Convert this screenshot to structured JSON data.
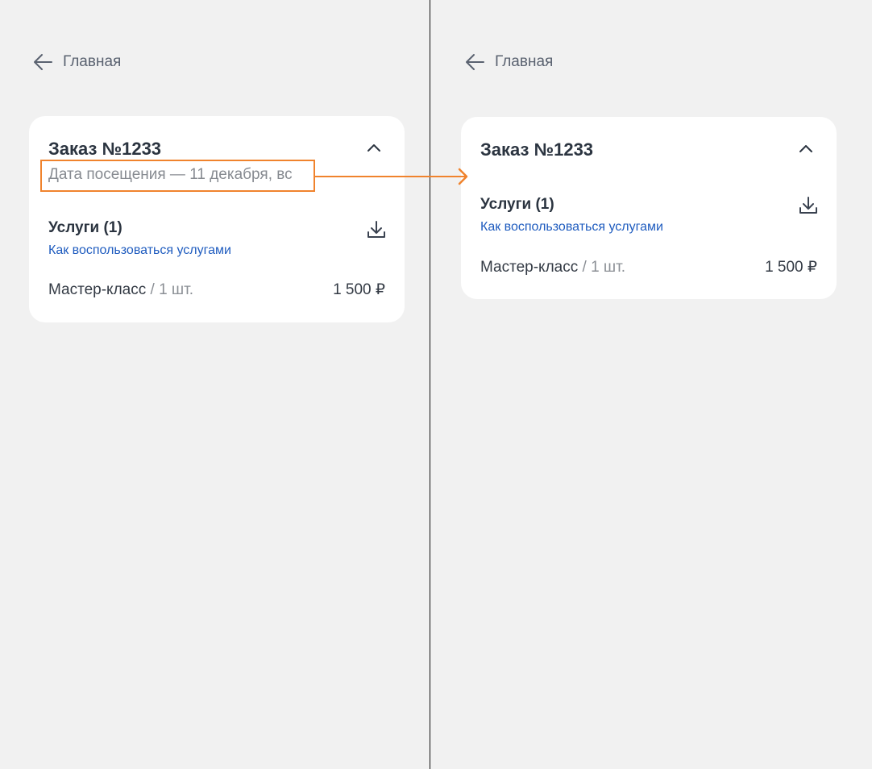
{
  "colors": {
    "background": "#f1f1f1",
    "card": "#ffffff",
    "title": "#2b3440",
    "muted": "#878b91",
    "link": "#1f5cbf",
    "annotation": "#f0832d"
  },
  "before": {
    "back_label": "Главная",
    "order_title": "Заказ №1233",
    "visit_date": "Дата посещения — 11 декабря, вс",
    "services_title": "Услуги (1)",
    "how_to_use_link": "Как воспользоваться услугами",
    "item_name": "Мастер-класс",
    "item_qty": " / 1 шт.",
    "item_price": "1 500 ₽",
    "icons": [
      "arrow-left-icon",
      "chevron-up-icon",
      "download-icon"
    ]
  },
  "after": {
    "back_label": "Главная",
    "order_title": "Заказ №1233",
    "services_title": "Услуги (1)",
    "how_to_use_link": "Как воспользоваться услугами",
    "item_name": "Мастер-класс",
    "item_qty": " / 1 шт.",
    "item_price": "1 500 ₽",
    "icons": [
      "arrow-left-icon",
      "chevron-up-icon",
      "download-icon"
    ]
  }
}
